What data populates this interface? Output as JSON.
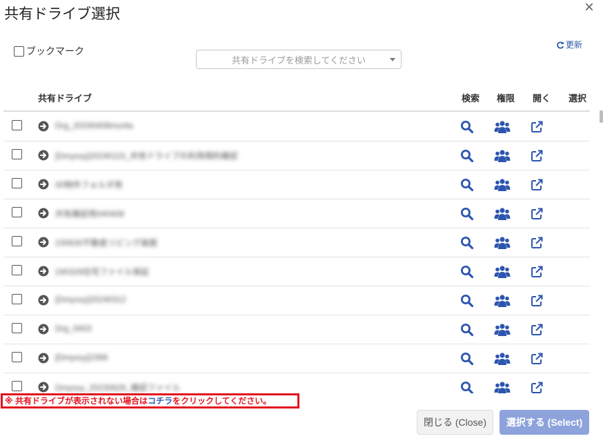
{
  "dialog": {
    "title": "共有ドライブ選択",
    "close_glyph": "×"
  },
  "toolbar": {
    "bookmark_label": "ブックマーク",
    "search_placeholder": "共有ドライブを検索してください",
    "refresh_label": "更新"
  },
  "table": {
    "headers": {
      "name": "共有ドライブ",
      "search": "検索",
      "permissions": "権限",
      "open": "開く",
      "select": "選択"
    },
    "rows": [
      {
        "name": "Drg_20240408morita"
      },
      {
        "name": "[Dmyssy]20240115_共有ドライブの利用規約確認"
      },
      {
        "name": "00物件フォルダ用"
      },
      {
        "name": "共有確認用040408"
      },
      {
        "name": "230630不動産リビング画面"
      },
      {
        "name": "240329住宅ファイル保証"
      },
      {
        "name": "[Dmyssy]20240312"
      },
      {
        "name": "Drg_0403"
      },
      {
        "name": "[Dmyssy]2399"
      },
      {
        "name": "Dmyssy_20230626_確認ファイル"
      }
    ]
  },
  "notice": {
    "prefix": "※ 共有ドライブが表示されない場合は",
    "link": "コチラ",
    "suffix": "をクリックしてください。"
  },
  "footer": {
    "close_button": "閉じる (Close)",
    "select_button": "選択する (Select)"
  },
  "colors": {
    "accent": "#2e5aa8",
    "icon_blue": "#2d55b0",
    "notice_red": "#e3141f",
    "select_button": "#8ea3dc"
  }
}
